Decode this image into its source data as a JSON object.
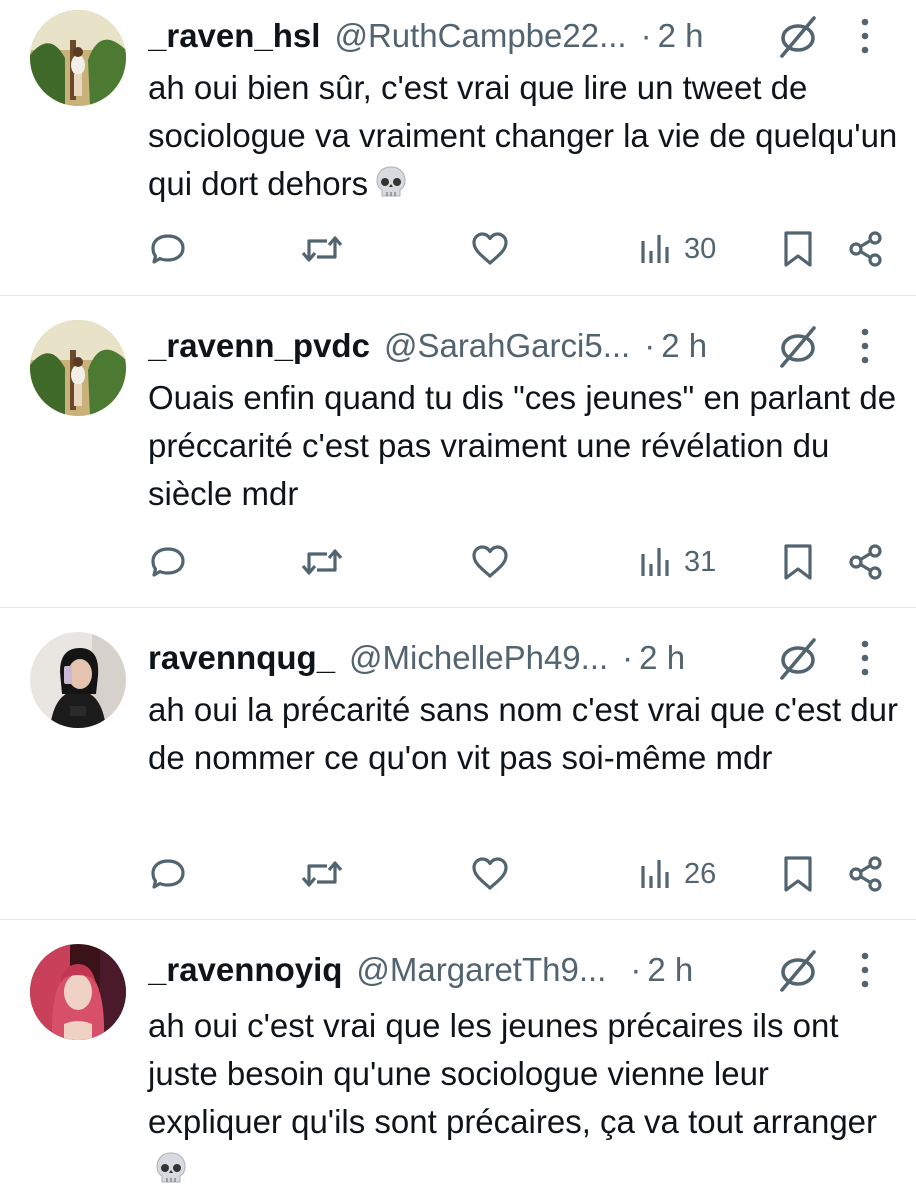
{
  "colors": {
    "muted": "#536471",
    "text": "#0f1419",
    "divider": "#e6e9ec"
  },
  "icons": {
    "reply": "speech-bubble-icon",
    "retweet": "retweet-icon",
    "like": "heart-icon",
    "views": "bar-chart-icon",
    "bookmark": "bookmark-icon",
    "share": "share-icon",
    "no_link": "no-link-icon",
    "more": "more-vertical-icon",
    "skull": "skull-emoji"
  },
  "tweets": [
    {
      "name": "_raven_hsl",
      "handle": "@RuthCampbe22...",
      "dot": "·",
      "time": "2 h",
      "text": "ah oui bien sûr, c'est vrai que lire un tweet de sociologue va vraiment changer la vie de quelqu'un qui dort dehors",
      "emoji": "💀",
      "views": "30"
    },
    {
      "name": "_ravenn_pvdc",
      "handle": "@SarahGarci5...",
      "dot": "·",
      "time": "2 h",
      "text": "Ouais enfin quand tu dis \"ces jeunes\" en parlant de préccarité c'est pas vraiment une révélation du siècle mdr",
      "views": "31"
    },
    {
      "name": "ravennqug_",
      "handle": "@MichellePh49...",
      "dot": "·",
      "time": "2 h",
      "text": "ah oui la précarité sans nom c'est vrai que c'est dur de nommer ce qu'on vit pas soi-même mdr",
      "views": "26"
    },
    {
      "name": "_ravennoyiq",
      "handle": "@MargaretTh9...",
      "dot": "·",
      "time": "2 h",
      "text": "ah oui c'est vrai que les jeunes précaires ils ont juste besoin qu'une sociologue vienne leur expliquer qu'ils sont précaires, ça va tout arranger",
      "emoji": "💀"
    }
  ]
}
